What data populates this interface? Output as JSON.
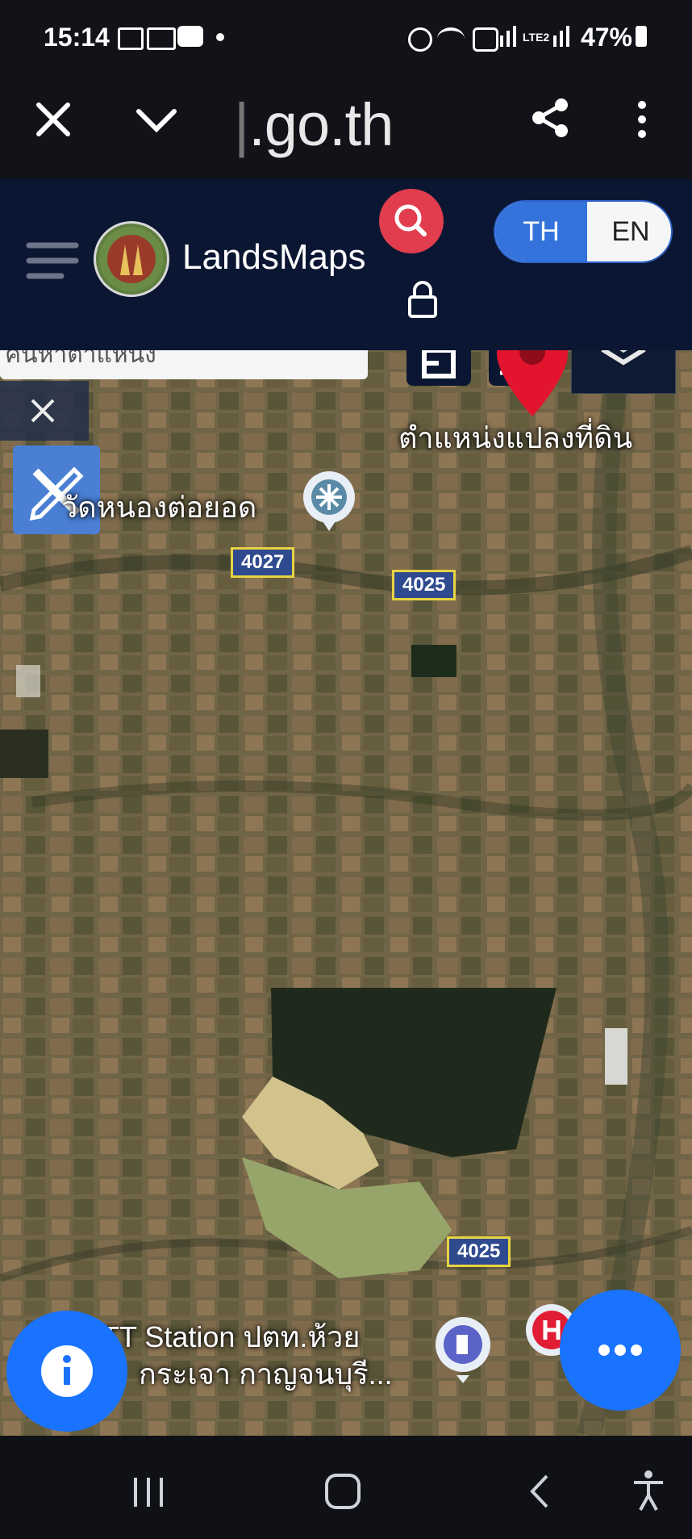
{
  "status": {
    "time": "15:14",
    "network": "LTE2",
    "battery": "47%"
  },
  "browser": {
    "url": ".go.th"
  },
  "header": {
    "brand": "LandsMaps",
    "lang_th": "TH",
    "lang_en": "EN"
  },
  "map": {
    "search_placeholder": "ค้นหาตำแหน่ง",
    "pin_label": "ตำแหน่งแปลงที่ดิน",
    "temple_label": "วัดหนองต่อยอด",
    "road_1": "4027",
    "road_2": "4025",
    "road_3": "4025",
    "station_label_1": "PTT Station ปตท.ห้วย",
    "station_label_2": "กระเจา กาญจนบุรี..."
  },
  "colors": {
    "header_bg": "#0b1732",
    "accent_blue": "#3473dc",
    "fab_blue": "#1a73ff",
    "search_red": "#e13d4e",
    "pin_red": "#e3142d"
  },
  "icons": {
    "close": "close-icon",
    "chevron": "chevron-down-icon",
    "share": "share-icon",
    "more": "more-vertical-icon",
    "menu": "hamburger-icon",
    "search": "search-icon",
    "lock": "lock-icon",
    "layers": "layers-icon",
    "draw": "pencil-ruler-icon",
    "info": "info-icon",
    "dots": "more-horizontal-icon"
  }
}
